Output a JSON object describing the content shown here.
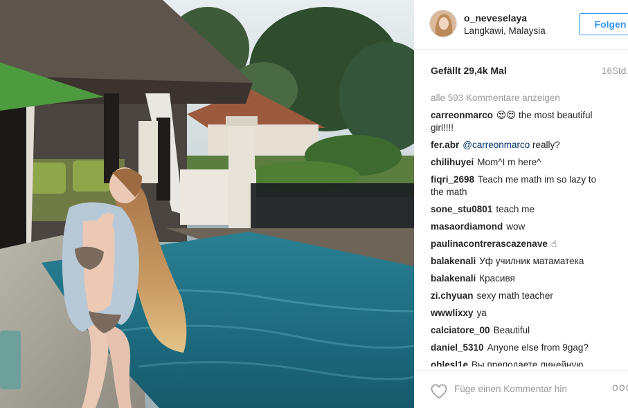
{
  "post": {
    "username": "o_neveselaya",
    "location": "Langkawi, Malaysia",
    "follow_label": "Folgen",
    "likes": "Gefällt 29,4k Mal",
    "time": "16Std."
  },
  "comments": {
    "load_more": "alle 593 Kommentare anzeigen",
    "items": [
      {
        "user": "carreonmarco",
        "text": "😍😍 the most beautiful girl!!!!"
      },
      {
        "user": "fer.abr",
        "mention": "@carreonmarco",
        "text": " really?"
      },
      {
        "user": "chilihuyei",
        "text": "Mom^I m here^"
      },
      {
        "user": "fiqri_2698",
        "text": "Teach me math im so lazy to the math"
      },
      {
        "user": "sone_stu0801",
        "text": "teach me"
      },
      {
        "user": "masaordiamond",
        "text": "wow"
      },
      {
        "user": "paulinacontrerascazenave",
        "text": "☝"
      },
      {
        "user": "balakenali",
        "text": "Уф училник матаматека"
      },
      {
        "user": "balakenali",
        "text": "Красивя"
      },
      {
        "user": "zi.chyuan",
        "text": "sexy math teacher"
      },
      {
        "user": "wwwlixxy",
        "text": "ya"
      },
      {
        "user": "calciatore_00",
        "text": "Beautiful"
      },
      {
        "user": "daniel_5310",
        "text": "Anyone else from 9gag?"
      },
      {
        "user": "ohlesl1e",
        "text": "Вы преподаете линейную"
      }
    ]
  },
  "footer": {
    "comment_placeholder": "Füge einen Kommentar hin",
    "more_label": "ooo",
    "heart_icon": "heart-outline-icon"
  },
  "colors": {
    "accent": "#3897f0",
    "muted": "#999999",
    "text": "#262626",
    "mention": "#003569"
  }
}
